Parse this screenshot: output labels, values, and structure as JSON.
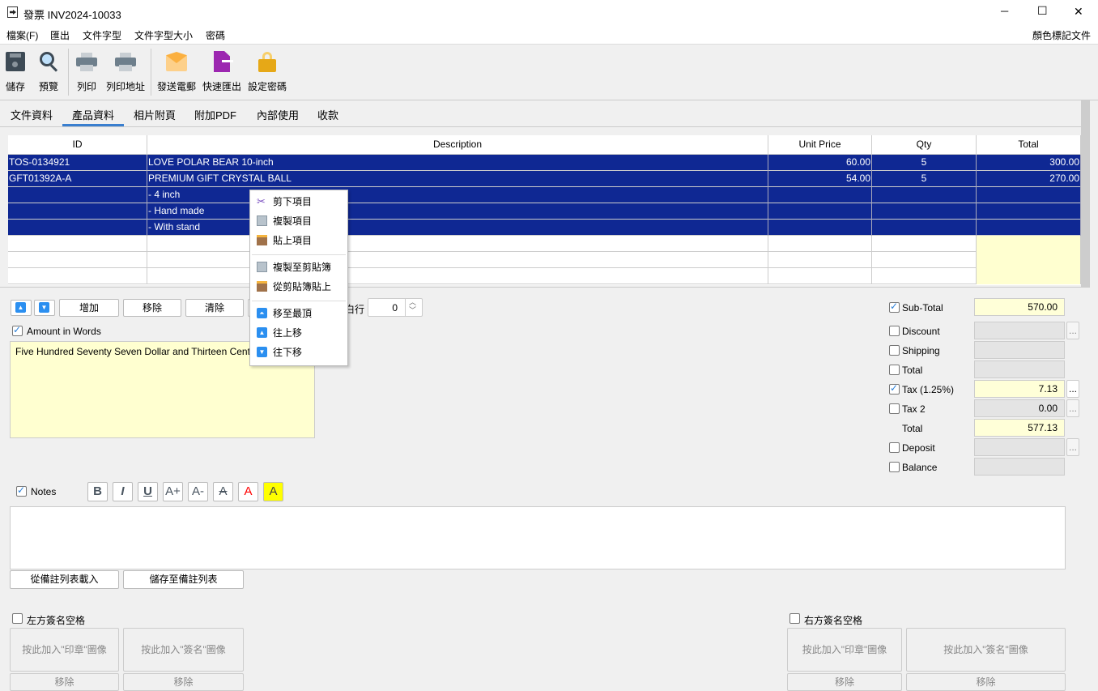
{
  "window": {
    "title": "發票 INV2024-10033",
    "minimize": "─",
    "maximize": "☐",
    "close": "✕"
  },
  "menu": {
    "items": [
      "檔案(F)",
      "匯出",
      "文件字型",
      "文件字型大小",
      "密碼"
    ],
    "right": "顏色標記文件"
  },
  "toolbar": {
    "items": [
      {
        "label": "儲存",
        "icon": "save-icon"
      },
      {
        "label": "預覽",
        "icon": "search-icon"
      },
      {
        "label": "列印",
        "icon": "printer-icon"
      },
      {
        "label": "列印地址",
        "icon": "printer-icon"
      },
      {
        "label": "發送電郵",
        "icon": "envelope-icon"
      },
      {
        "label": "快速匯出",
        "icon": "export-file-icon"
      },
      {
        "label": "設定密碼",
        "icon": "lock-icon"
      }
    ]
  },
  "tabs": {
    "items": [
      "文件資料",
      "產品資料",
      "相片附頁",
      "附加PDF",
      "內部使用",
      "收款"
    ],
    "active": 1
  },
  "table": {
    "columns": [
      "ID",
      "Description",
      "Unit Price",
      "Qty",
      "Total"
    ],
    "rows": [
      [
        "TOS-0134921",
        "LOVE POLAR BEAR 10-inch",
        "60.00",
        "5",
        "300.00"
      ],
      [
        "GFT01392A-A",
        "PREMIUM GIFT CRYSTAL BALL",
        "54.00",
        "5",
        "270.00"
      ],
      [
        "",
        "- 4 inch",
        "",
        "",
        ""
      ],
      [
        "",
        "- Hand made",
        "",
        "",
        ""
      ],
      [
        "",
        "- With stand",
        "",
        "",
        ""
      ],
      [
        "",
        "",
        "",
        "",
        ""
      ],
      [
        "",
        "",
        "",
        "",
        ""
      ],
      [
        "",
        "",
        "",
        "",
        ""
      ]
    ]
  },
  "row_controls": {
    "add": "增加",
    "remove": "移除",
    "clear": "清除",
    "blank_rows_label": "白行",
    "blank_rows_value": "0"
  },
  "amount_words": {
    "label": "Amount in Words",
    "checked": true,
    "text": "Five Hundred Seventy Seven Dollar and Thirteen Cents"
  },
  "totals": [
    {
      "label": "Sub-Total",
      "checked": true,
      "value": "570.00",
      "has_checkbox": true
    },
    {
      "label": "Discount",
      "checked": false,
      "value": "",
      "has_checkbox": true,
      "dots": true
    },
    {
      "label": "Shipping",
      "checked": false,
      "value": "",
      "has_checkbox": true
    },
    {
      "label": "Total",
      "checked": false,
      "value": "",
      "has_checkbox": true
    },
    {
      "label": "Tax (1.25%)",
      "checked": true,
      "value": "7.13",
      "has_checkbox": true,
      "dots": true
    },
    {
      "label": "Tax 2",
      "checked": false,
      "value": "0.00",
      "has_checkbox": true,
      "dots": true
    },
    {
      "label": "Total",
      "value": "577.13",
      "has_checkbox": false
    },
    {
      "label": "Deposit",
      "checked": false,
      "value": "",
      "has_checkbox": true,
      "dots": true
    },
    {
      "label": "Balance",
      "checked": false,
      "value": "",
      "has_checkbox": true
    }
  ],
  "dots_label": "...",
  "notes": {
    "label": "Notes",
    "checked": true,
    "format_buttons": [
      "B",
      "I",
      "U",
      "A+",
      "A-",
      "A",
      "A",
      "A"
    ],
    "text": "",
    "load": "從備註列表載入",
    "save": "儲存至備註列表"
  },
  "signature": {
    "left_label": "左方簽名空格",
    "right_label": "右方簽名空格",
    "stamp": "按此加入\"印章\"圖像",
    "sign": "按此加入\"簽名\"圖像",
    "remove": "移除"
  },
  "context_menu": {
    "items": [
      "剪下項目",
      "複製項目",
      "貼上項目",
      "複製至剪貼簿",
      "從剪貼簿貼上",
      "移至最頂",
      "往上移",
      "往下移"
    ]
  },
  "colors": {
    "selection": "#0f2893",
    "highlight": "#ffffd8",
    "accent": "#3a7fcf"
  }
}
